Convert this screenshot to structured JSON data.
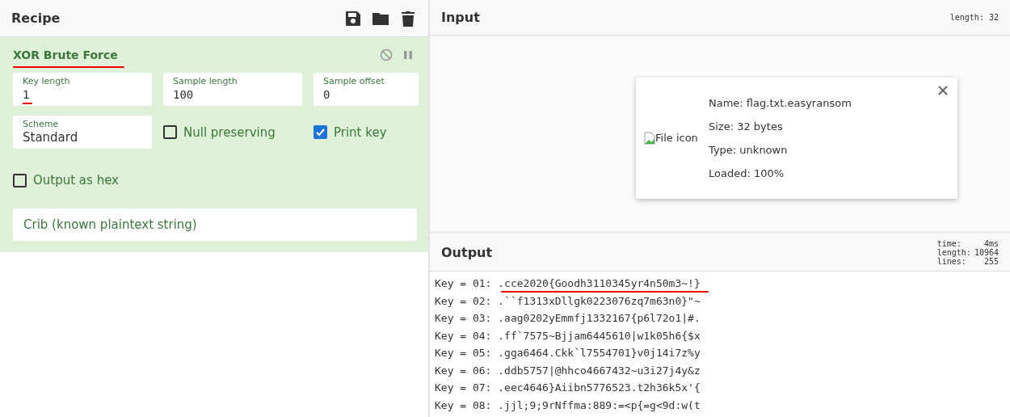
{
  "recipe": {
    "title": "Recipe",
    "operation": {
      "title": "XOR Brute Force",
      "annotated": true,
      "fields": [
        {
          "kind": "number",
          "label": "Key length",
          "value": "1",
          "annotated": true
        },
        {
          "kind": "number",
          "label": "Sample length",
          "value": "100",
          "annotated": false
        },
        {
          "kind": "number",
          "label": "Sample offset",
          "value": "0",
          "annotated": false
        },
        {
          "kind": "select",
          "label": "Scheme",
          "value": "Standard",
          "annotated": false
        }
      ],
      "checkboxes": [
        {
          "label": "Null preserving",
          "checked": false
        },
        {
          "label": "Print key",
          "checked": true
        },
        {
          "label": "Output as hex",
          "checked": false
        }
      ],
      "crib": {
        "placeholder": "Crib (known plaintext string)"
      }
    }
  },
  "input": {
    "title": "Input",
    "length_label": "length:",
    "length": "32",
    "file": {
      "icon_alt": "File icon",
      "details": [
        "Name: flag.txt.easyransom",
        "Size: 32 bytes",
        "Type: unknown",
        "Loaded: 100%"
      ]
    }
  },
  "output": {
    "title": "Output",
    "stats": [
      {
        "label": "time:",
        "value": "4ms"
      },
      {
        "label": "length:",
        "value": "10964"
      },
      {
        "label": "lines:",
        "value": "255"
      }
    ],
    "lines": [
      {
        "text": "Key = 01: .cce2020{Goodh3110345yr4n50m3~!}",
        "annotated": true
      },
      {
        "text": "Key = 02: .``f1313xDllgk0223076zq7m63n0}\"~",
        "annotated": false
      },
      {
        "text": "Key = 03: .aag0202yEmmfj1332167{p6l72o1|#.",
        "annotated": false
      },
      {
        "text": "Key = 04: .ff`7575~Bjjam6445610|w1k05h6{$x",
        "annotated": false
      },
      {
        "text": "Key = 05: .gga6464.Ckk`l7554701}v0j14i7z%y",
        "annotated": false
      },
      {
        "text": "Key = 06: .ddb5757|@hhco4667432~u3i27j4y&z",
        "annotated": false
      },
      {
        "text": "Key = 07: .eec4646}Aiibn5776523.t2h36k5x'{",
        "annotated": false
      },
      {
        "text": "Key = 08: .jjl;9;9rNffma:889:=<p{=g<9d:w(t",
        "annotated": false
      }
    ]
  }
}
